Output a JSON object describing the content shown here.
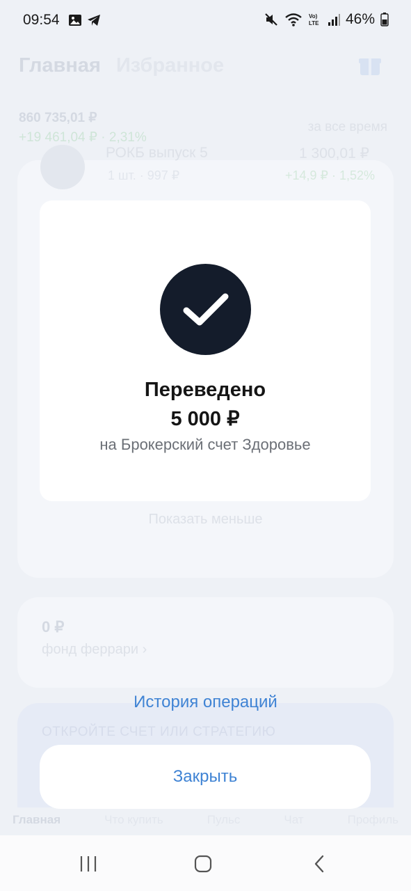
{
  "status_bar": {
    "time": "09:54",
    "battery": "46%",
    "icons": [
      "image-icon",
      "telegram-icon",
      "mute-icon",
      "wifi-icon",
      "volte-icon",
      "signal-icon",
      "battery-icon"
    ]
  },
  "background": {
    "tabs": [
      "Главная",
      "Избранное"
    ],
    "total": "860 735,01 ₽",
    "change": "+19 461,04 ₽ · 2,31%",
    "period": "за все время",
    "security": {
      "name": "РОКБ выпуск 5",
      "qty": "1 шт. · 997 ₽",
      "value": "1 300,01 ₽",
      "change": "+14,9 ₽ · 1,52%"
    },
    "show_less": "Показать меньше",
    "fund_value": "0 ₽",
    "fund_name": "фонд феррари ›",
    "promo": "ОТКРОЙТЕ СЧЕТ ИЛИ СТРАТЕГИЮ",
    "nav": [
      "Главная",
      "Что купить",
      "Пульс",
      "Чат",
      "Профиль"
    ]
  },
  "modal": {
    "title": "Переведено",
    "amount": "5 000 ₽",
    "description": "на Брокерский счет Здоровье"
  },
  "actions": {
    "history": "История операций",
    "close": "Закрыть"
  },
  "colors": {
    "accent": "#3f83d4",
    "check_bg": "#141c2b"
  }
}
